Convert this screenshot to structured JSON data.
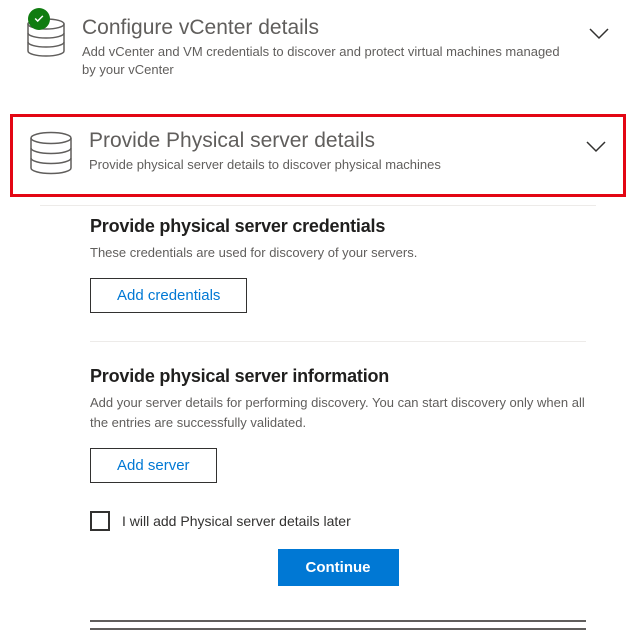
{
  "sections": {
    "vcenter": {
      "title": "Configure vCenter details",
      "subtitle": "Add vCenter and VM credentials to discover and protect virtual machines managed by your vCenter",
      "completed": true
    },
    "physical": {
      "title": "Provide Physical server details",
      "subtitle": "Provide physical server details to discover physical machines"
    }
  },
  "credentials": {
    "heading": "Provide physical server credentials",
    "description": "These credentials are used for discovery of your servers.",
    "button": "Add credentials"
  },
  "information": {
    "heading": "Provide physical server information",
    "description": "Add your server details for performing discovery. You can start discovery only when all the entries are successfully validated.",
    "button": "Add server"
  },
  "later_checkbox": "I will add Physical server details later",
  "continue_button": "Continue"
}
